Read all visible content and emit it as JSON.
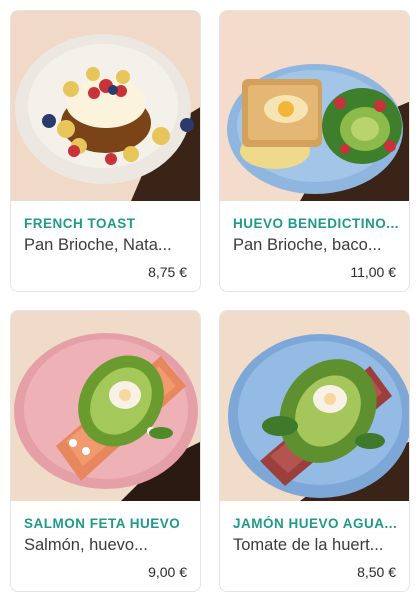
{
  "colors": {
    "accent": "#1f9a8a"
  },
  "items": [
    {
      "name": "FRENCH TOAST",
      "description": "Pan Brioche, Nata...",
      "price": "8,75 €",
      "image": "french-toast-photo"
    },
    {
      "name": "HUEVO BENEDICTINO...",
      "description": "Pan Brioche, baco...",
      "price": "11,00 €",
      "image": "eggs-benedict-photo"
    },
    {
      "name": "SALMON FETA HUEVO",
      "description": "Salmón, huevo...",
      "price": "9,00 €",
      "image": "salmon-toast-photo"
    },
    {
      "name": "JAMÓN HUEVO AGUA...",
      "description": "Tomate de la huert...",
      "price": "8,50 €",
      "image": "ham-egg-toast-photo"
    }
  ]
}
